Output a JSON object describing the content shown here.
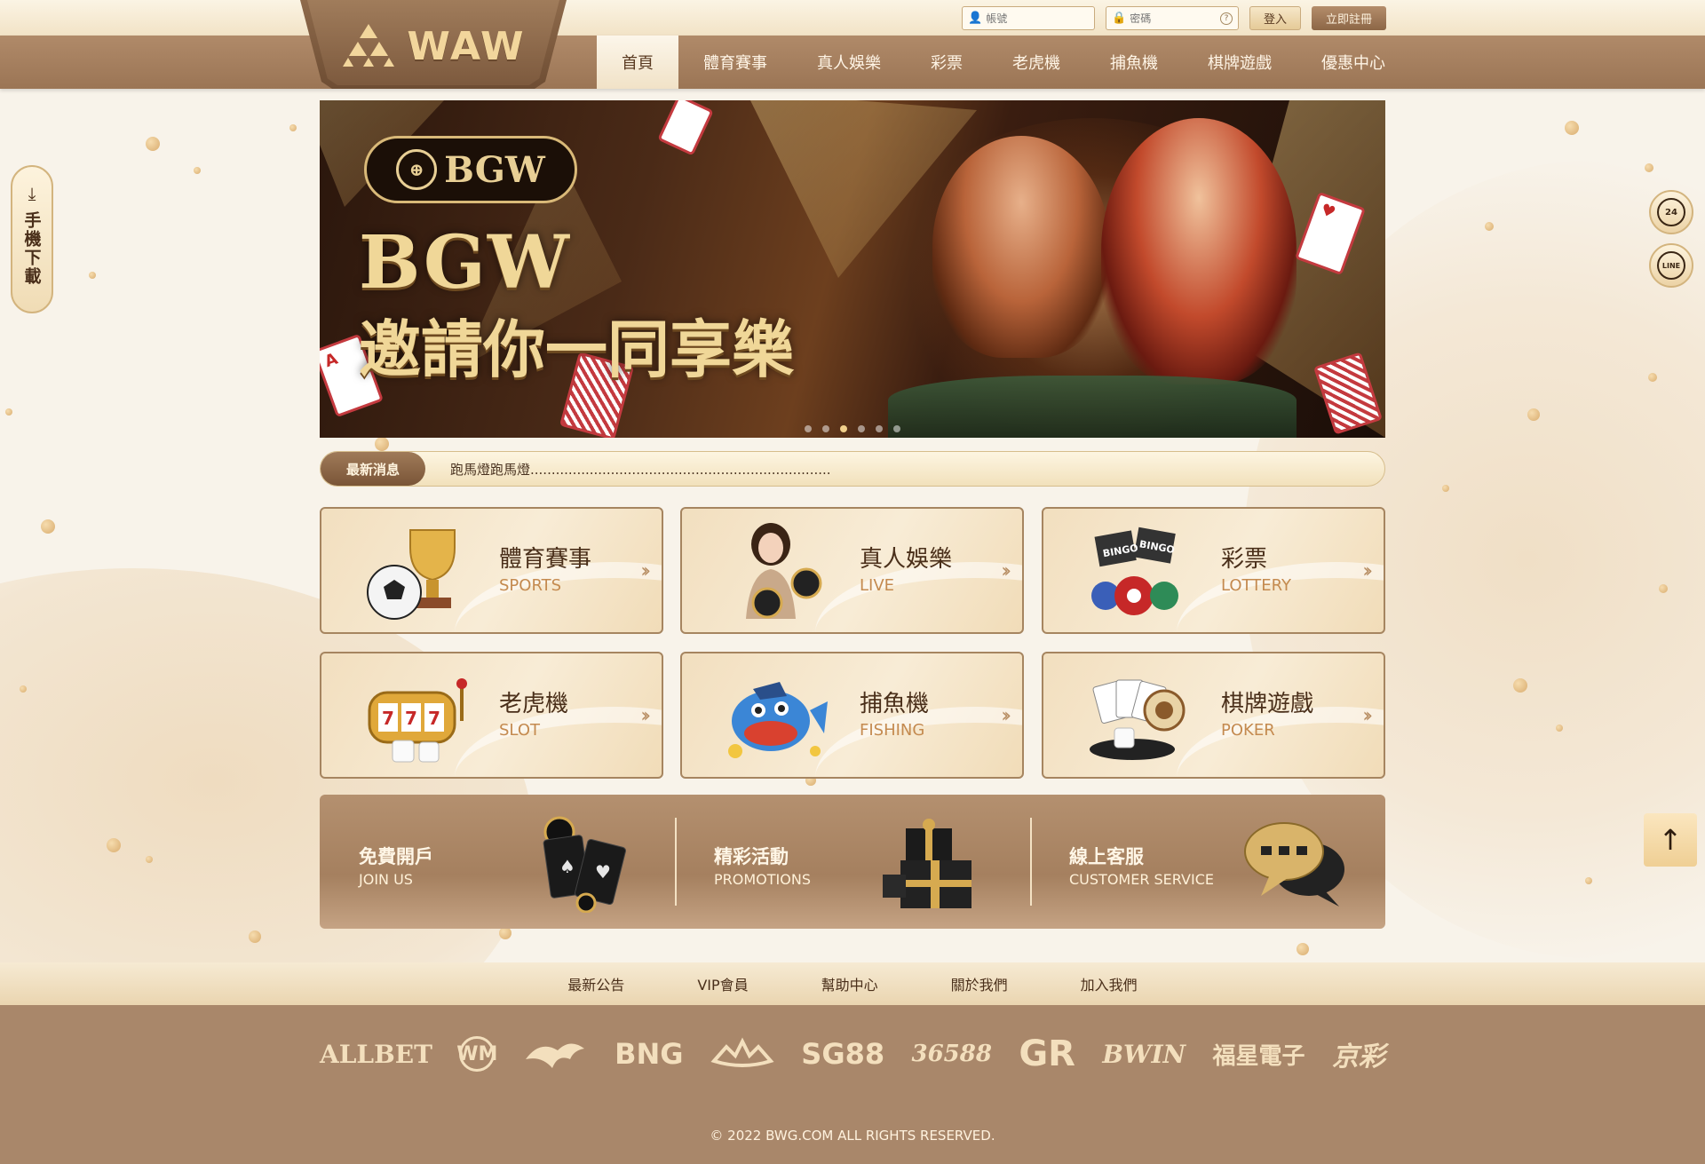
{
  "header": {
    "logo": "WAW",
    "account_placeholder": "帳號",
    "password_placeholder": "密碼",
    "login_label": "登入",
    "register_label": "立即註冊"
  },
  "nav": {
    "items": [
      {
        "label": "首頁",
        "active": true
      },
      {
        "label": "體育賽事"
      },
      {
        "label": "真人娛樂"
      },
      {
        "label": "彩票"
      },
      {
        "label": "老虎機"
      },
      {
        "label": "捕魚機"
      },
      {
        "label": "棋牌遊戲"
      },
      {
        "label": "優惠中心"
      }
    ]
  },
  "banner": {
    "badge": "BGW",
    "title": "BGW",
    "subtitle": "邀請你一同享樂",
    "slide_count": 6,
    "active_slide": 3
  },
  "news": {
    "tag": "最新消息",
    "text": "跑馬燈跑馬燈......................................................................."
  },
  "categories": [
    {
      "title": "體育賽事",
      "en": "SPORTS",
      "icon": "trophy-soccer-icon"
    },
    {
      "title": "真人娛樂",
      "en": "LIVE",
      "icon": "live-dealer-icon"
    },
    {
      "title": "彩票",
      "en": "LOTTERY",
      "icon": "bingo-balls-icon"
    },
    {
      "title": "老虎機",
      "en": "SLOT",
      "icon": "slot-machine-icon"
    },
    {
      "title": "捕魚機",
      "en": "FISHING",
      "icon": "fish-icon"
    },
    {
      "title": "棋牌遊戲",
      "en": "POKER",
      "icon": "poker-chips-icon"
    }
  ],
  "promo": [
    {
      "title": "免費開戶",
      "en": "JOIN US",
      "icon": "cards-chips-icon"
    },
    {
      "title": "精彩活動",
      "en": "PROMOTIONS",
      "icon": "gift-boxes-icon"
    },
    {
      "title": "線上客服",
      "en": "CUSTOMER SERVICE",
      "icon": "chat-bubble-icon"
    }
  ],
  "side": {
    "download_label": "手機下載",
    "support_label": "24",
    "line_label": "LINE"
  },
  "footer": {
    "links": [
      "最新公告",
      "VIP會員",
      "幫助中心",
      "關於我們",
      "加入我們"
    ],
    "partners": [
      "ALLBET",
      "WM",
      "",
      "BNG",
      "",
      "SG88",
      "36588",
      "GR",
      "BWIN",
      "福星電子",
      "京彩"
    ],
    "copyright": "© 2022 BWG.COM ALL RIGHTS RESERVED."
  },
  "colors": {
    "nav_bg": "#a5805f",
    "accent_gold": "#f0d798",
    "page_bg": "#f8f3ea"
  }
}
